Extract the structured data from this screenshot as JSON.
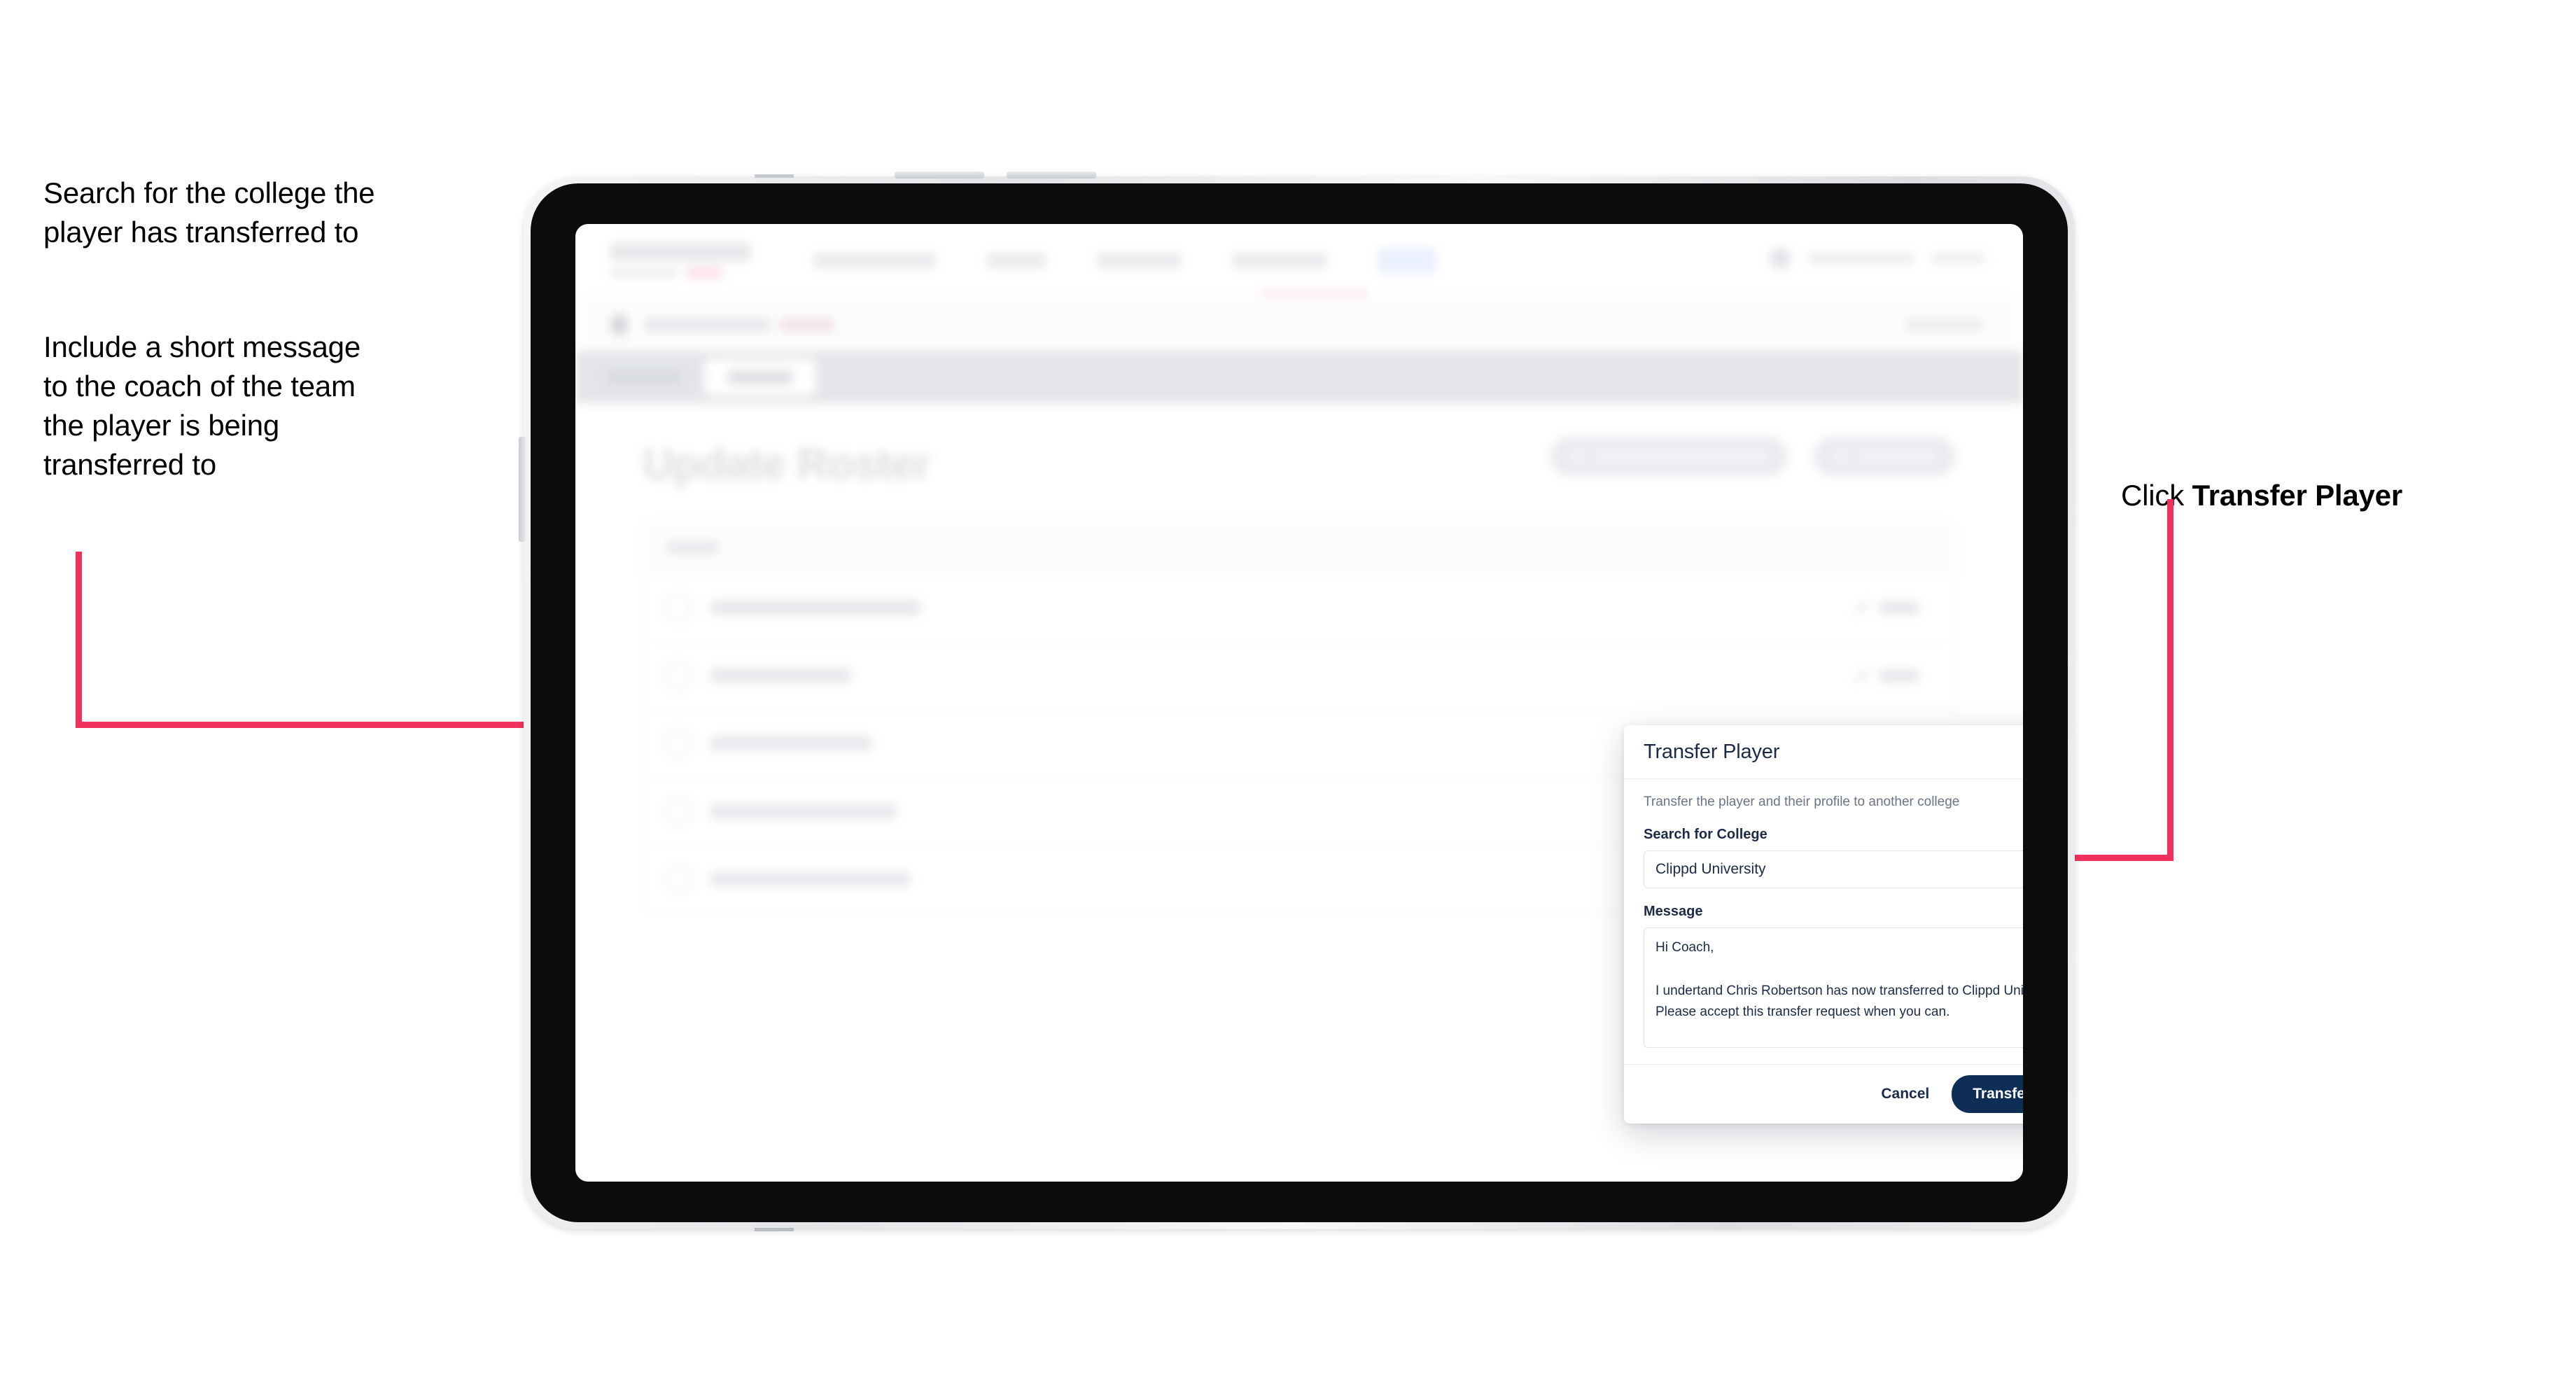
{
  "annotations": {
    "search_note": "Search for the college the\nplayer has transferred to",
    "message_note": "Include a short message\nto the coach of the team\nthe player is being\ntransferred to",
    "click_prefix": "Click ",
    "click_target": "Transfer Player"
  },
  "colors": {
    "accent_pink": "#f2315f",
    "primary_navy": "#0f2e55",
    "tabbar_grey": "#d3d6db",
    "text_dark": "#1b2a47",
    "text_muted": "#6b7485",
    "border": "#dfe2e7"
  },
  "app": {
    "page_title": "Update Roster",
    "row_count": 5
  },
  "modal": {
    "title": "Transfer Player",
    "close_icon": "close-icon",
    "subtitle": "Transfer the player and their profile to another college",
    "college_label": "Search for College",
    "college_value": "Clippd University",
    "college_placeholder": "Search for College",
    "message_label": "Message",
    "message_value": "Hi Coach,\n\nI undertand Chris Robertson has now transferred to Clippd University. Please accept this transfer request when you can.",
    "message_placeholder": "Message",
    "cancel_label": "Cancel",
    "submit_label": "Transfer Player"
  }
}
